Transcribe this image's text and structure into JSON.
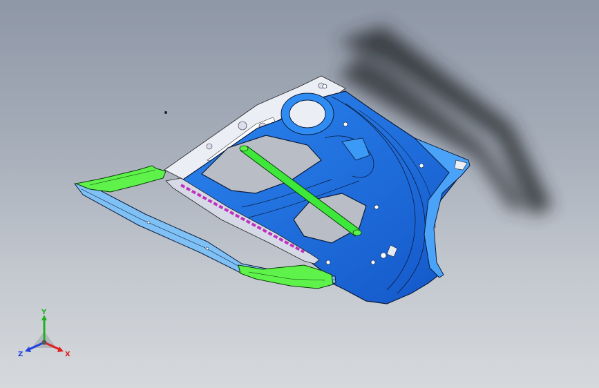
{
  "viewport": {
    "background_top": "#8e97a6",
    "background_bottom": "#d6d9dc"
  },
  "model": {
    "panel_color": "#1f6fe0",
    "edge_color": "#0a1a3a",
    "bar_color": "#3ee83a",
    "accent_color": "#c030c0",
    "flange_color": "#e8eaf2"
  },
  "triad": {
    "x_label": "X",
    "y_label": "Y",
    "z_label": "Z",
    "x_color": "#e02020",
    "y_color": "#20b020",
    "z_color": "#2040e0"
  }
}
